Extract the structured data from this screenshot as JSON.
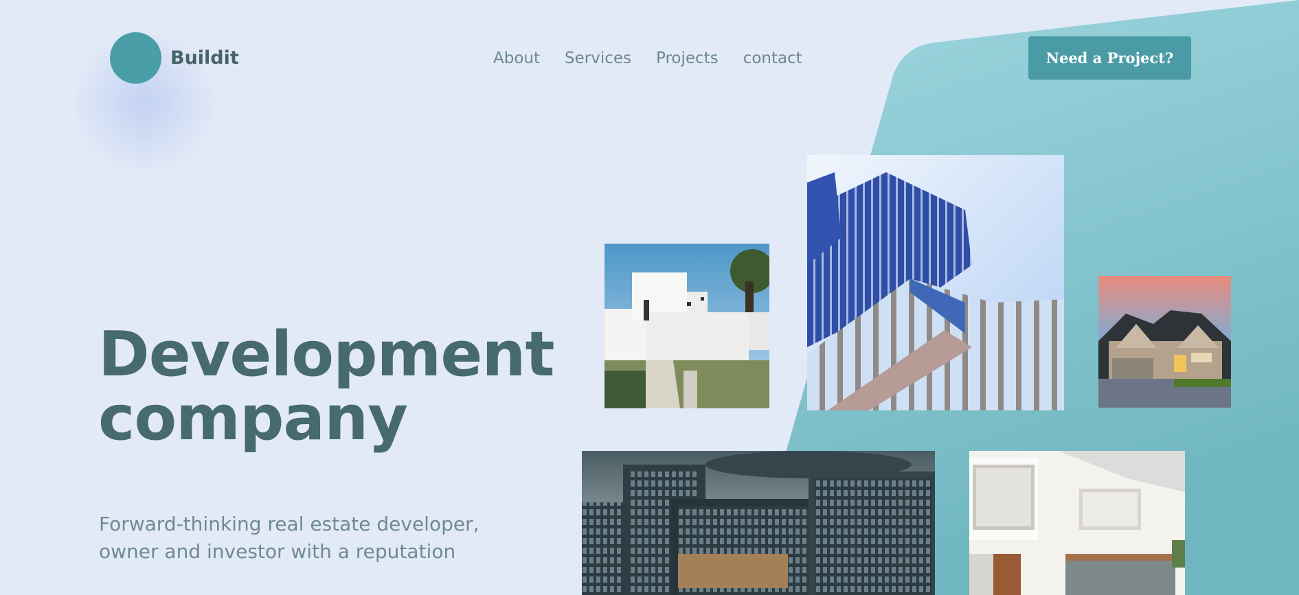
{
  "brand": {
    "name": "Buildit"
  },
  "nav": {
    "items": [
      {
        "label": "About"
      },
      {
        "label": "Services"
      },
      {
        "label": "Projects"
      },
      {
        "label": "contact"
      }
    ]
  },
  "cta": {
    "label": "Need a Project?"
  },
  "hero": {
    "title_line1": "Development",
    "title_line2": "company",
    "subtitle_line1": "Forward-thinking real estate developer,",
    "subtitle_line2": "owner and investor with a reputation"
  },
  "gallery": [
    {
      "subject": "white modern villa"
    },
    {
      "subject": "blue glass skyscraper"
    },
    {
      "subject": "suburban house at sunset"
    },
    {
      "subject": "office buildings"
    },
    {
      "subject": "white modern house with pergola"
    }
  ],
  "colors": {
    "background": "#e3eaf7",
    "accent_teal": "#4a9ea8",
    "heading": "#476a6e",
    "body_text": "#6f8a92"
  }
}
